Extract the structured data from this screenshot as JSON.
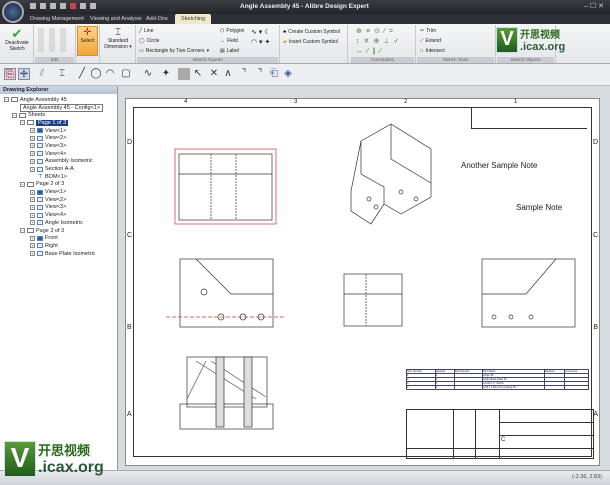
{
  "window": {
    "title": "Angle Assembly 45 - Alibre Design Expert",
    "controls": "– ☐ ✕"
  },
  "tabs": [
    "Drawing Management",
    "Viewing and Analysis",
    "Add-Ons",
    "Sketching"
  ],
  "ribbon": {
    "deactivate": "Deactivate Sketch",
    "select": "Select",
    "std_dim": "Standard Dimension",
    "line": "Line",
    "circle": "Circle",
    "rect": "Rectangle by Two Corners",
    "polygon": "Polygon",
    "field": "Field",
    "label": "Label",
    "create_symbol": "Create Custom Symbol",
    "insert_symbol": "Insert Custom Symbol",
    "trim": "Trim",
    "extend": "Extend",
    "intersect": "Intersect",
    "groups": {
      "edit": "Edit",
      "sketch_figures": "Sketch Figures",
      "constraints": "Constraints",
      "sketch_tools": "Sketch Tools",
      "sketch_objects": "Sketch Objects"
    }
  },
  "explorer": {
    "title": "Drawing Explorer",
    "root": "Angle Assembly 45",
    "config": "Angle Assembly 45 - Config<1>",
    "sheets": "Sheets",
    "pages": [
      {
        "label": "Page 1 of 3",
        "items": [
          "View<1>",
          "View<2>",
          "View<3>",
          "View<4>",
          "Assembly Isometric",
          "Section A-A",
          "BOM<1>"
        ]
      },
      {
        "label": "Page 2 of 3",
        "items": [
          "View<1>",
          "View<2>",
          "View<3>",
          "View<4>",
          "Angle Isometric"
        ]
      },
      {
        "label": "Page 3 of 3",
        "items": [
          "Front",
          "Right",
          "Base Plate Isometric"
        ]
      }
    ]
  },
  "drawing": {
    "notes": [
      "Another Sample Note",
      "Sample Note"
    ],
    "zones_top": [
      "4",
      "3",
      "2",
      "1"
    ],
    "zones_side": [
      "D",
      "C",
      "B",
      "A"
    ],
    "bom": {
      "headers": [
        "Item Number",
        "Quantity",
        "Part Number",
        "Part Name",
        "Revision",
        "Comments"
      ],
      "rows": [
        [
          "1",
          "1",
          "",
          "Angle 45",
          "",
          ""
        ],
        [
          "2",
          "1",
          "",
          "Angle Base Plate 45",
          "",
          ""
        ],
        [
          "3",
          "4",
          "",
          "1/4-20 x 1\" SHCS",
          "",
          ""
        ],
        [
          "4",
          "4",
          "",
          "0.25 x 1.00 Inch Locating Pin",
          "",
          ""
        ]
      ]
    },
    "size": "C"
  },
  "status": {
    "coords": "(-2.36, 2.83)"
  },
  "watermark": {
    "letter": "V",
    "cn": "开思视频",
    "site": ".icax.org"
  }
}
